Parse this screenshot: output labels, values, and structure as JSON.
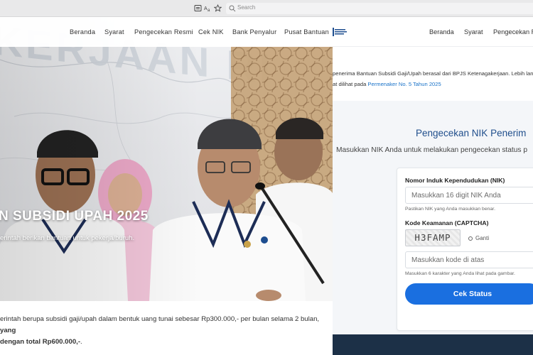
{
  "toolbar": {
    "search_placeholder": "Search"
  },
  "left_page": {
    "nav": [
      "Beranda",
      "Syarat",
      "Pengecekan Resmi",
      "Cek NIK",
      "Bank Penyalur",
      "Pusat Bantuan"
    ],
    "hero_title": "N SUBSIDI UPAH 2025",
    "hero_subtitle": "erintah berikan bantuan untuk pekerja/buruh.",
    "intro_text": "erintah berupa subsidi gaji/upah dalam bentuk uang tunai sebesar Rp300.000,- per bulan selama 2 bulan,",
    "intro_bold_1": "yang",
    "intro_bold_2": "dengan total Rp600.000,-",
    "intro_end": "."
  },
  "right_page": {
    "nav": [
      "Beranda",
      "Syarat",
      "Pengecekan R"
    ],
    "notice_line_1": "penerima Bantuan Subsidi Gaji/Upah berasal dari BPJS Ketenagakerjaan. Lebih lanjut",
    "notice_line_2_prefix": "at dilihat pada",
    "notice_link": "Permenaker No. 5 Tahun 2025",
    "form_title": "Pengecekan NIK Penerim",
    "form_subtitle": "Masukkan NIK Anda untuk melakukan pengecekan status p",
    "nik_label": "Nomor Induk Kependudukan (NIK)",
    "nik_placeholder": "Masukkan 16 digit NIK Anda",
    "nik_hint": "Pastikan NIK yang Anda masukkan benar.",
    "captcha_label": "Kode Keamanan (CAPTCHA)",
    "captcha_code": "H3FAMP",
    "refresh_label": "Ganti",
    "captcha_placeholder": "Masukkan kode di atas",
    "captcha_hint": "Masukkan 6 karakter yang Anda lihat pada gambar.",
    "submit_label": "Cek Status"
  },
  "colors": {
    "accent": "#1a6fe0",
    "title": "#1f4e8c",
    "link": "#1a73c9",
    "footer": "#1c3047"
  }
}
